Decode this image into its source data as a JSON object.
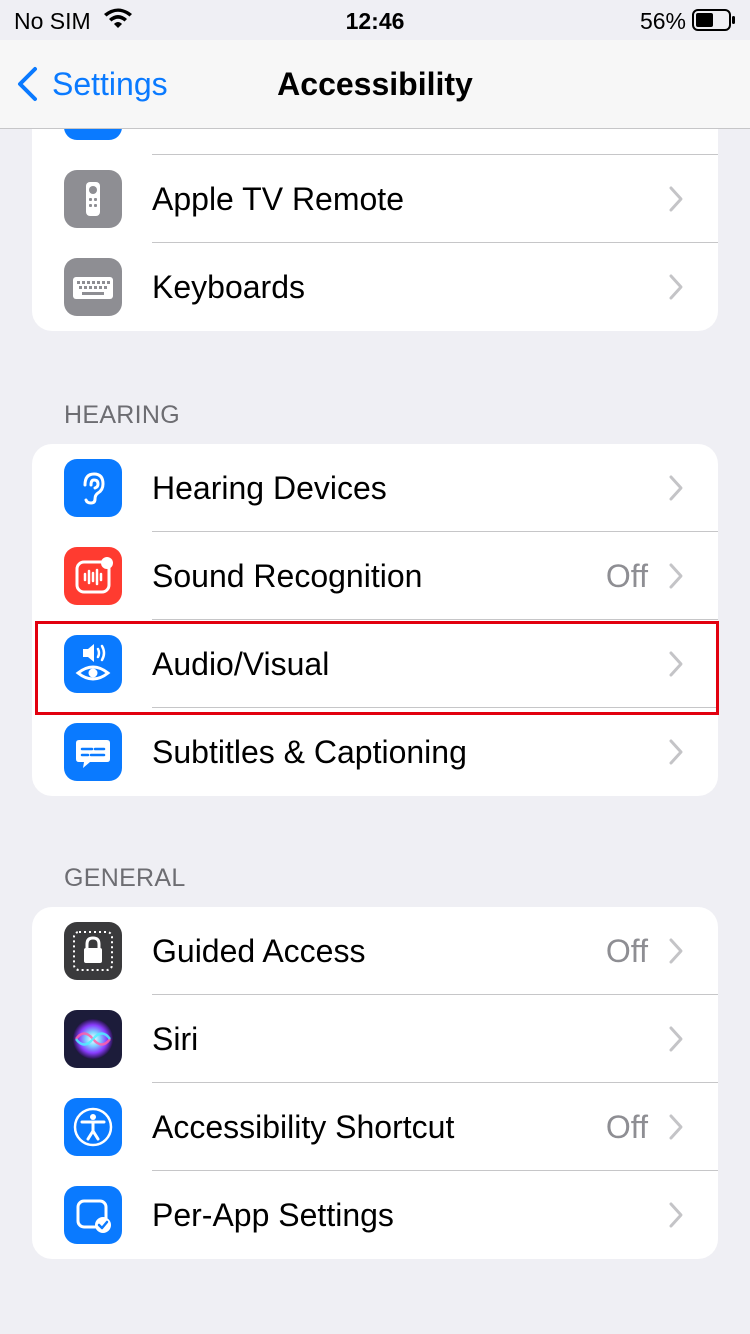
{
  "status_bar": {
    "carrier": "No SIM",
    "time": "12:46",
    "battery_percent": "56%",
    "battery_level": 0.56
  },
  "nav": {
    "back_label": "Settings",
    "title": "Accessibility"
  },
  "groups": [
    {
      "header": "",
      "rows": [
        {
          "label": "Apple TV Remote",
          "value": "",
          "icon": "apple-tv-remote-icon",
          "icon_color": "#8e8e93"
        },
        {
          "label": "Keyboards",
          "value": "",
          "icon": "keyboard-icon",
          "icon_color": "#8e8e93"
        }
      ]
    },
    {
      "header": "HEARING",
      "rows": [
        {
          "label": "Hearing Devices",
          "value": "",
          "icon": "ear-icon",
          "icon_color": "#0a7aff"
        },
        {
          "label": "Sound Recognition",
          "value": "Off",
          "icon": "sound-recognition-icon",
          "icon_color": "#ff3b30"
        },
        {
          "label": "Audio/Visual",
          "value": "",
          "icon": "speaker-eye-icon",
          "icon_color": "#0a7aff"
        },
        {
          "label": "Subtitles & Captioning",
          "value": "",
          "icon": "caption-bubble-icon",
          "icon_color": "#0a7aff"
        }
      ]
    },
    {
      "header": "GENERAL",
      "rows": [
        {
          "label": "Guided Access",
          "value": "Off",
          "icon": "lock-icon",
          "icon_color": "#3a3a3c"
        },
        {
          "label": "Siri",
          "value": "",
          "icon": "siri-icon",
          "icon_color": "#1c1c3a"
        },
        {
          "label": "Accessibility Shortcut",
          "value": "Off",
          "icon": "accessibility-icon",
          "icon_color": "#0a7aff"
        },
        {
          "label": "Per-App Settings",
          "value": "",
          "icon": "per-app-icon",
          "icon_color": "#0a7aff"
        }
      ]
    }
  ],
  "highlight_color": "#e2000f"
}
